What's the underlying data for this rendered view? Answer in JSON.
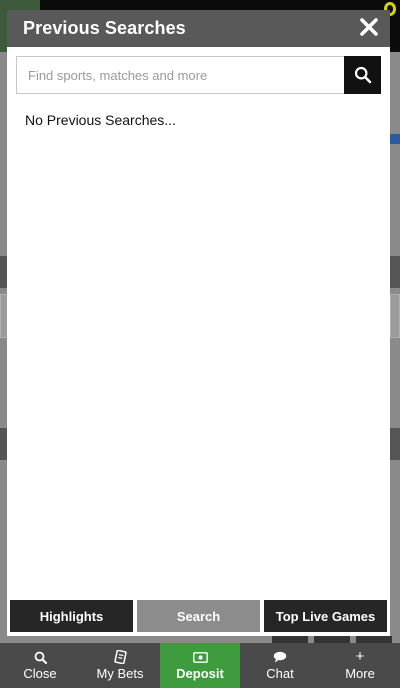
{
  "modal": {
    "title": "Previous Searches",
    "search": {
      "placeholder": "Find sports, matches and more",
      "value": ""
    },
    "empty_message": "No Previous Searches...",
    "tabs": [
      {
        "label": "Highlights",
        "active": false
      },
      {
        "label": "Search",
        "active": true
      },
      {
        "label": "Top Live Games",
        "active": false
      }
    ]
  },
  "bottom_nav": {
    "items": [
      {
        "label": "Close",
        "icon": "search-icon"
      },
      {
        "label": "My Bets",
        "icon": "bet-slip-icon"
      },
      {
        "label": "Deposit",
        "icon": "cash-icon"
      },
      {
        "label": "Chat",
        "icon": "chat-bubble-icon"
      },
      {
        "label": "More",
        "icon": "plus-icon"
      }
    ]
  },
  "colors": {
    "header_bg": "#595959",
    "tab_dark": "#262626",
    "tab_active": "#8c8c8c",
    "nav_bg": "#4a4a4a",
    "deposit_green": "#3e9b3e"
  }
}
